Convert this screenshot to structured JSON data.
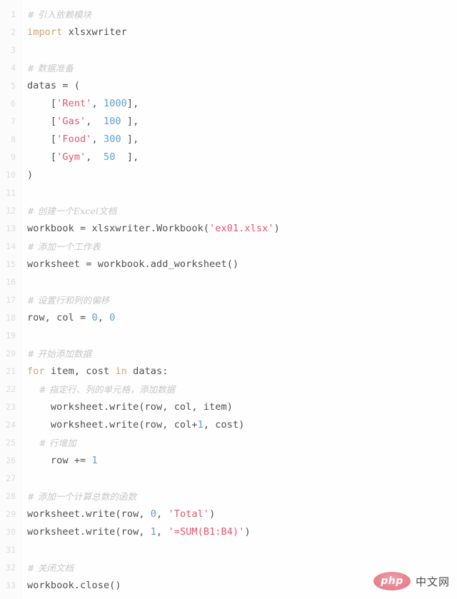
{
  "editor": {
    "language": "python",
    "background_color": "#fefefe",
    "gutter_color": "#fbfbfb",
    "line_number_color": "#dcdcdc",
    "colors": {
      "comment": "#c6c6c6",
      "keyword": "#cfa36b",
      "string": "#e0566f",
      "number": "#5aa0d8",
      "plain": "#4f4f4f"
    },
    "total_lines": 33,
    "lines": [
      {
        "n": "1",
        "tokens": [
          {
            "t": "comment",
            "v": "# 引入依赖模块"
          }
        ]
      },
      {
        "n": "2",
        "tokens": [
          {
            "t": "keyword",
            "v": "import"
          },
          {
            "t": "plain",
            "v": " xlsxwriter"
          }
        ]
      },
      {
        "n": "3",
        "tokens": []
      },
      {
        "n": "4",
        "tokens": [
          {
            "t": "comment",
            "v": "# 数据准备"
          }
        ]
      },
      {
        "n": "5",
        "tokens": [
          {
            "t": "plain",
            "v": "datas = ("
          }
        ]
      },
      {
        "n": "6",
        "tokens": [
          {
            "t": "plain",
            "v": "    ["
          },
          {
            "t": "string",
            "v": "'Rent'"
          },
          {
            "t": "plain",
            "v": ", "
          },
          {
            "t": "number",
            "v": "1000"
          },
          {
            "t": "plain",
            "v": "],"
          }
        ]
      },
      {
        "n": "7",
        "tokens": [
          {
            "t": "plain",
            "v": "    ["
          },
          {
            "t": "string",
            "v": "'Gas'"
          },
          {
            "t": "plain",
            "v": ",  "
          },
          {
            "t": "number",
            "v": "100"
          },
          {
            "t": "plain",
            "v": " ],"
          }
        ]
      },
      {
        "n": "8",
        "tokens": [
          {
            "t": "plain",
            "v": "    ["
          },
          {
            "t": "string",
            "v": "'Food'"
          },
          {
            "t": "plain",
            "v": ", "
          },
          {
            "t": "number",
            "v": "300"
          },
          {
            "t": "plain",
            "v": " ],"
          }
        ]
      },
      {
        "n": "9",
        "tokens": [
          {
            "t": "plain",
            "v": "    ["
          },
          {
            "t": "string",
            "v": "'Gym'"
          },
          {
            "t": "plain",
            "v": ",  "
          },
          {
            "t": "number",
            "v": "50"
          },
          {
            "t": "plain",
            "v": "  ],"
          }
        ]
      },
      {
        "n": "10",
        "tokens": [
          {
            "t": "plain",
            "v": ")"
          }
        ]
      },
      {
        "n": "11",
        "tokens": []
      },
      {
        "n": "12",
        "tokens": [
          {
            "t": "comment",
            "v": "# 创建一个Excel文档"
          }
        ]
      },
      {
        "n": "13",
        "tokens": [
          {
            "t": "plain",
            "v": "workbook = xlsxwriter.Workbook("
          },
          {
            "t": "string",
            "v": "'ex01.xlsx'"
          },
          {
            "t": "plain",
            "v": ")"
          }
        ]
      },
      {
        "n": "14",
        "tokens": [
          {
            "t": "comment",
            "v": "# 添加一个工作表"
          }
        ]
      },
      {
        "n": "15",
        "tokens": [
          {
            "t": "plain",
            "v": "worksheet = workbook.add_worksheet()"
          }
        ]
      },
      {
        "n": "16",
        "tokens": []
      },
      {
        "n": "17",
        "tokens": [
          {
            "t": "comment",
            "v": "# 设置行和列的偏移"
          }
        ]
      },
      {
        "n": "18",
        "tokens": [
          {
            "t": "plain",
            "v": "row, col = "
          },
          {
            "t": "number",
            "v": "0"
          },
          {
            "t": "plain",
            "v": ", "
          },
          {
            "t": "number",
            "v": "0"
          }
        ]
      },
      {
        "n": "19",
        "tokens": []
      },
      {
        "n": "20",
        "tokens": [
          {
            "t": "comment",
            "v": "# 开始添加数据"
          }
        ]
      },
      {
        "n": "21",
        "tokens": [
          {
            "t": "keyword",
            "v": "for"
          },
          {
            "t": "plain",
            "v": " item, cost "
          },
          {
            "t": "keyword",
            "v": "in"
          },
          {
            "t": "plain",
            "v": " datas:"
          }
        ]
      },
      {
        "n": "22",
        "tokens": [
          {
            "t": "comment",
            "v": "    # 指定行、列的单元格，添加数据"
          }
        ]
      },
      {
        "n": "23",
        "tokens": [
          {
            "t": "plain",
            "v": "    worksheet.write(row, col, item)"
          }
        ]
      },
      {
        "n": "24",
        "tokens": [
          {
            "t": "plain",
            "v": "    worksheet.write(row, col+"
          },
          {
            "t": "number",
            "v": "1"
          },
          {
            "t": "plain",
            "v": ", cost)"
          }
        ]
      },
      {
        "n": "25",
        "tokens": [
          {
            "t": "comment",
            "v": "    # 行增加"
          }
        ]
      },
      {
        "n": "26",
        "tokens": [
          {
            "t": "plain",
            "v": "    row += "
          },
          {
            "t": "number",
            "v": "1"
          }
        ]
      },
      {
        "n": "27",
        "tokens": []
      },
      {
        "n": "28",
        "tokens": [
          {
            "t": "comment",
            "v": "# 添加一个计算总数的函数"
          }
        ]
      },
      {
        "n": "29",
        "tokens": [
          {
            "t": "plain",
            "v": "worksheet.write(row, "
          },
          {
            "t": "number",
            "v": "0"
          },
          {
            "t": "plain",
            "v": ", "
          },
          {
            "t": "string",
            "v": "'Total'"
          },
          {
            "t": "plain",
            "v": ")"
          }
        ]
      },
      {
        "n": "30",
        "tokens": [
          {
            "t": "plain",
            "v": "worksheet.write(row, "
          },
          {
            "t": "number",
            "v": "1"
          },
          {
            "t": "plain",
            "v": ", "
          },
          {
            "t": "string",
            "v": "'=SUM(B1:B4)'"
          },
          {
            "t": "plain",
            "v": ")"
          }
        ]
      },
      {
        "n": "31",
        "tokens": []
      },
      {
        "n": "32",
        "tokens": [
          {
            "t": "comment",
            "v": "# 关闭文档"
          }
        ]
      },
      {
        "n": "33",
        "tokens": [
          {
            "t": "plain",
            "v": "workbook.close()"
          }
        ]
      }
    ]
  },
  "watermark": {
    "logo_text": "php",
    "site_text": "中文网",
    "logo_color": "#de6a7c"
  }
}
